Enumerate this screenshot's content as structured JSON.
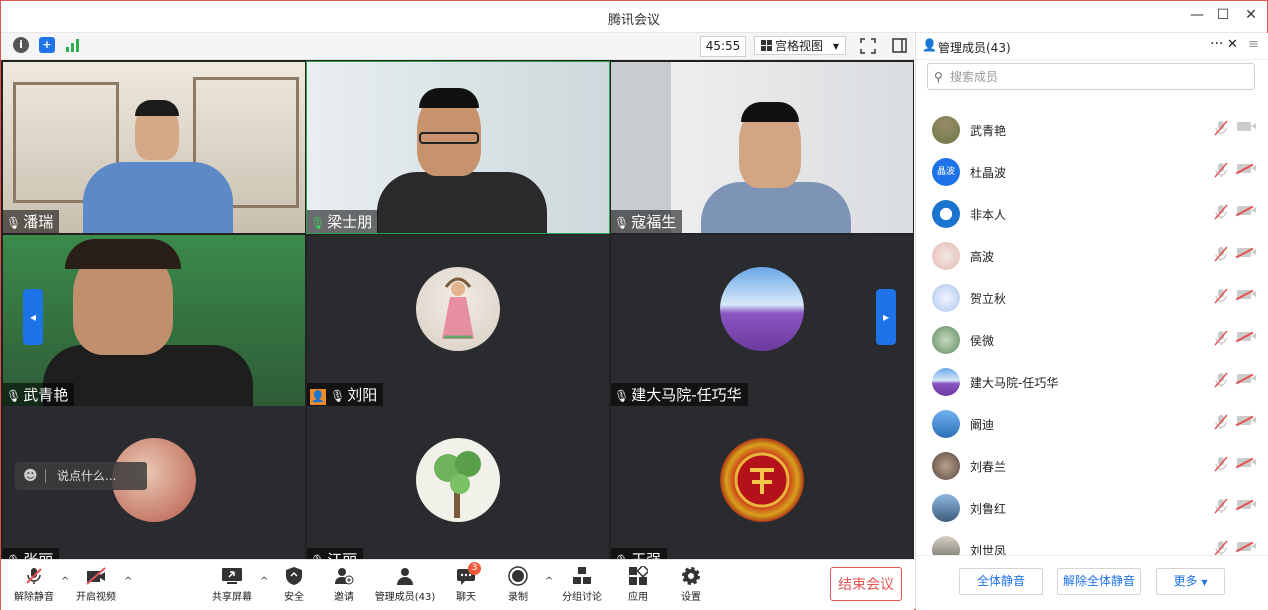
{
  "window": {
    "title": "腾讯会议"
  },
  "toolbar": {
    "timer": "45:55",
    "view_label": "宫格视图"
  },
  "tiles": [
    {
      "name": "潘瑞"
    },
    {
      "name": "梁士朋"
    },
    {
      "name": "寇福生"
    },
    {
      "name": "武青艳"
    },
    {
      "name": "刘阳"
    },
    {
      "name": "建大马院-任巧华"
    },
    {
      "name": "张丽",
      "partial": true
    },
    {
      "name": "江丽",
      "partial": true
    },
    {
      "name": "王强",
      "partial": true
    }
  ],
  "chat": {
    "placeholder": "说点什么..."
  },
  "bottom": {
    "unmute": "解除静音",
    "video": "开启视频",
    "share": "共享屏幕",
    "security": "安全",
    "invite": "邀请",
    "members": "管理成员(43)",
    "chat": "聊天",
    "chat_badge": "3",
    "record": "录制",
    "breakout": "分组讨论",
    "apps": "应用",
    "settings": "设置",
    "end": "结束会议"
  },
  "panel": {
    "title": "管理成员(43)",
    "search_placeholder": "搜索成员",
    "members": [
      {
        "name": "武青艳",
        "video_on": true
      },
      {
        "name": "杜晶波",
        "avatar_text": "晶波"
      },
      {
        "name": "非本人"
      },
      {
        "name": "高波"
      },
      {
        "name": "贺立秋"
      },
      {
        "name": "侯微"
      },
      {
        "name": "建大马院-任巧华"
      },
      {
        "name": "阚迪"
      },
      {
        "name": "刘春兰"
      },
      {
        "name": "刘鲁红"
      },
      {
        "name": "刘世凤"
      }
    ],
    "mute_all": "全体静音",
    "unmute_all": "解除全体静音",
    "more": "更多"
  },
  "colors": {
    "accent": "#1e73e8",
    "danger": "#e25555"
  }
}
